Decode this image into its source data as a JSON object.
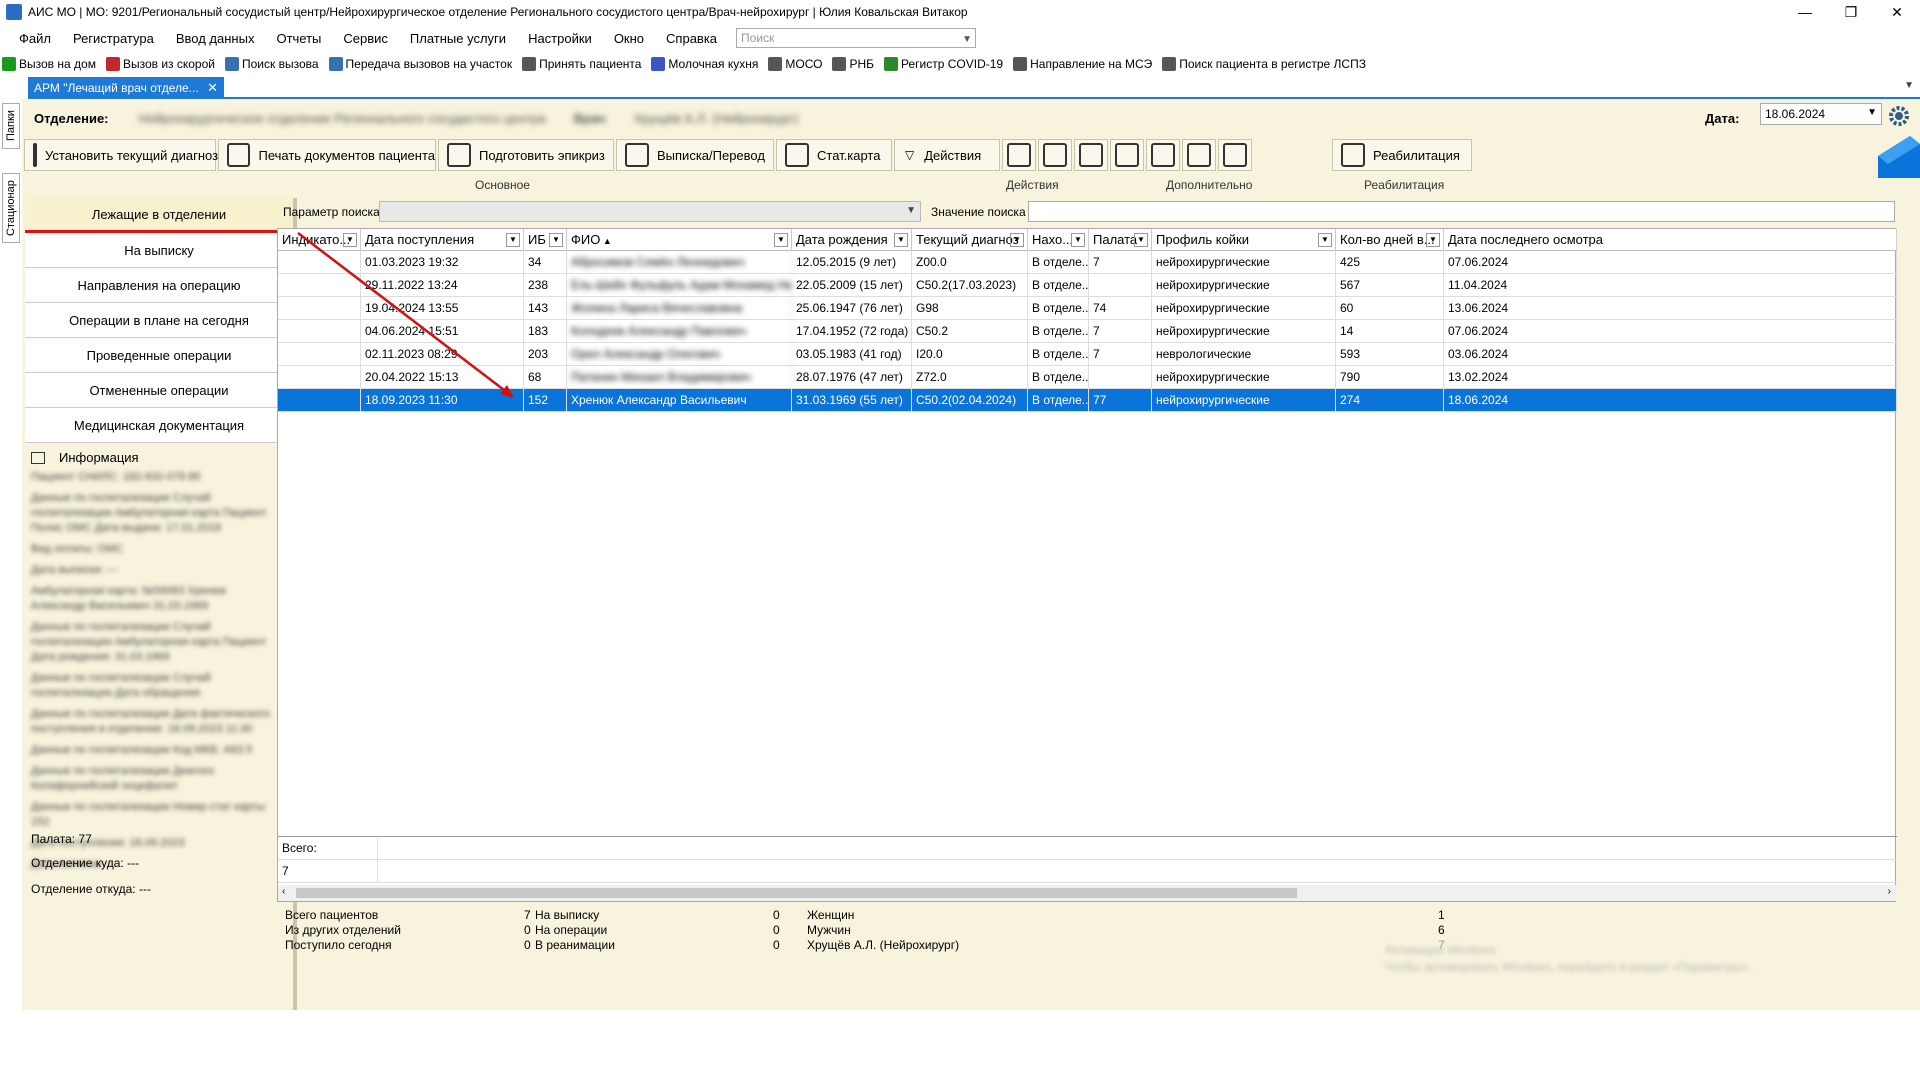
{
  "window": {
    "title": "АИС МО | МО: 9201/Региональный сосудистый центр/Нейрохирургическое отделение Регионального сосудистого центра/Врач-нейрохирург | Юлия Ковальская Витакор",
    "minimize": "—",
    "restore": "❐",
    "close": "✕"
  },
  "menu": {
    "items": [
      "Файл",
      "Регистратура",
      "Ввод данных",
      "Отчеты",
      "Сервис",
      "Платные услуги",
      "Настройки",
      "Окно",
      "Справка"
    ],
    "search_placeholder": "Поиск"
  },
  "quickbar": [
    {
      "label": "Вызов на дом",
      "icon": "house-call-icon",
      "color": "#1a9a1a"
    },
    {
      "label": "Вызов из скорой",
      "icon": "ambulance-call-icon",
      "color": "#c0282d"
    },
    {
      "label": "Поиск вызова",
      "icon": "search-call-icon",
      "color": "#3a6fb0"
    },
    {
      "label": "Передача вызовов на участок",
      "icon": "transfer-call-icon",
      "color": "#3a6fb0"
    },
    {
      "label": "Принять пациента",
      "icon": "accept-patient-icon",
      "color": "#555555"
    },
    {
      "label": "Молочная кухня",
      "icon": "milk-kitchen-icon",
      "color": "#3a57c4"
    },
    {
      "label": "МОСО",
      "icon": "moso-icon",
      "color": "#555555"
    },
    {
      "label": "РНБ",
      "icon": "rnb-icon",
      "color": "#555555"
    },
    {
      "label": "Регистр COVID-19",
      "icon": "covid-icon",
      "color": "#2c8a2c"
    },
    {
      "label": "Направление на МСЭ",
      "icon": "mse-referral-icon",
      "color": "#555555"
    },
    {
      "label": "Поиск пациента в регистре ЛСПЗ",
      "icon": "lspz-search-icon",
      "color": "#555555"
    }
  ],
  "tab": {
    "label": "АРМ \"Лечащий врач отделе...",
    "close": "✕"
  },
  "side_tabs": [
    "Папки",
    "Стационар"
  ],
  "header": {
    "dept_label": "Отделение:",
    "dept_value": "Нейрохирургическое отделение Регионального сосудистого центра",
    "doctor_role": "Врач",
    "doctor_name": "Хрущёв А.Л. (Нейрохирург)",
    "date_label": "Дата:",
    "date_value": "18.06.2024"
  },
  "toolbar": {
    "set_diagnosis": "Установить текущий диагноз",
    "print_docs": "Печать документов пациента",
    "prepare_epicrisis": "Подготовить эпикриз",
    "discharge_transfer": "Выписка/Перевод",
    "stat_card": "Стат.карта",
    "actions": "Действия",
    "rehab": "Реабилитация",
    "groups": {
      "main": "Основное",
      "actions": "Действия",
      "extra": "Дополнительно",
      "rehab": "Реабилитация"
    }
  },
  "nav": {
    "items": [
      "Лежащие в отделении",
      "На выписку",
      "Направления на операцию",
      "Операции в плане на сегодня",
      "Проведенные операции",
      "Отмененные операции",
      "Медицинская документация"
    ]
  },
  "info": {
    "title": "Информация",
    "blurred_lines": [
      "Пациент СНИЛС: 182-932-078 85",
      "Данные по госпитализации Случай госпитализации Амбулаторная карта Пациент Полис ОМС Дата выдачи: 17.01.2018",
      "Вид оплаты: ОМС",
      "Дата выписки: ---",
      "Амбулаторная карта: №59083 Хренюк Александр Васильевич 31.03.1969",
      "Данные по госпитализации Случай госпитализации Амбулаторная карта Пациент Дата рождения: 31.03.1969",
      "Данные по госпитализации Случай госпитализации Дата обращения",
      "Данные по госпитализации Дата фактического поступления в отделение: 18.09.2023 11:30",
      "Данные по госпитализации Код МКБ: A83.5",
      "Данные по госпитализации Диагноз Колафорнийский энцефалит",
      "Данные по госпитализации Номер стат карты: 152",
      "Дата поступления: 18.09.2023",
      "Дата выписки: ---"
    ],
    "ward": "Палата: 77",
    "dept_to": "Отделение куда: ---",
    "dept_from": "Отделение откуда: ---"
  },
  "search": {
    "param_label": "Параметр поиска",
    "value_label": "Значение поиска"
  },
  "grid": {
    "columns": [
      "Индикато...",
      "Дата поступления",
      "ИБ",
      "ФИО",
      "Дата рождения",
      "Текущий диагноз",
      "Нахо...",
      "Палата",
      "Профиль койки",
      "Кол-во дней в...",
      "Дата последнего осмотра"
    ],
    "rows": [
      [
        "",
        "01.03.2023 19:32",
        "34",
        "Абросимов Семён Леонидович",
        "12.05.2015 (9 лет)",
        "Z00.0",
        "В отделе...",
        "7",
        "нейрохирургические",
        "425",
        "07.06.2024"
      ],
      [
        "",
        "29.11.2022 13:24",
        "238",
        "Ель-Шейх Фульфуль Адам Мохамед Ню...",
        "22.05.2009 (15 лет)",
        "C50.2(17.03.2023)",
        "В отделе...",
        "",
        "нейрохирургические",
        "567",
        "11.04.2024"
      ],
      [
        "",
        "19.04.2024 13:55",
        "143",
        "Жолина Лариса Вячеславовна",
        "25.06.1947 (76 лет)",
        "G98",
        "В отделе...",
        "74",
        "нейрохирургические",
        "60",
        "13.06.2024"
      ],
      [
        "",
        "04.06.2024 15:51",
        "183",
        "Колодеев Александр Павлович",
        "17.04.1952 (72 года)",
        "C50.2",
        "В отделе...",
        "7",
        "нейрохирургические",
        "14",
        "07.06.2024"
      ],
      [
        "",
        "02.11.2023 08:29",
        "203",
        "Орел Александр Олегович",
        "03.05.1983 (41 год)",
        "I20.0",
        "В отделе...",
        "7",
        "неврологические",
        "593",
        "03.06.2024"
      ],
      [
        "",
        "20.04.2022 15:13",
        "68",
        "Патанин Михаил Владимирович",
        "28.07.1976 (47 лет)",
        "Z72.0",
        "В отделе...",
        "",
        "нейрохирургические",
        "790",
        "13.02.2024"
      ],
      [
        "",
        "18.09.2023 11:30",
        "152",
        "Хренюк Александр Васильевич",
        "31.03.1969 (55 лет)",
        "C50.2(02.04.2024)",
        "В отделе...",
        "77",
        "нейрохирургические",
        "274",
        "18.06.2024"
      ]
    ],
    "selected_row": 6,
    "sort_column": "ФИО",
    "total_label": "Всего:",
    "total_value": "7"
  },
  "summary": {
    "total_patients_label": "Всего пациентов",
    "total_patients": "7",
    "from_other_label": "Из других отделений",
    "from_other": "0",
    "arrived_today_label": "Поступило сегодня",
    "arrived_today": "0",
    "discharge_label": "На выписку",
    "discharge": "0",
    "surgery_label": "На операции",
    "surgery": "0",
    "icu_label": "В реанимации",
    "icu": "0",
    "women_label": "Женщин",
    "women": "1",
    "men_label": "Мужчин",
    "men": "6",
    "doctor_label": "Хрущёв А.Л. (Нейрохирург)",
    "doctor_count": "7"
  },
  "watermark": {
    "line1": "Активация Windows",
    "line2": "Чтобы активировать Windows, перейдите в раздел «Параметры»."
  },
  "colors": {
    "selection": "#0a74da",
    "panel_bg": "#f7f3dc",
    "active_tab": "#1e7ad6",
    "annotation_arrow": "#d11111"
  }
}
